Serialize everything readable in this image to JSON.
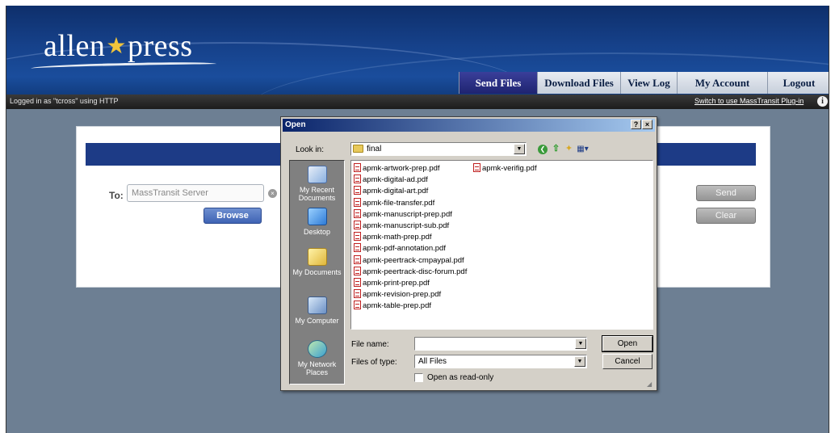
{
  "header": {
    "logo_left": "allen",
    "logo_right": "press",
    "logo_star": "★"
  },
  "nav": {
    "tabs": [
      {
        "label": "Send Files",
        "active": true
      },
      {
        "label": "Download Files",
        "active": false
      },
      {
        "label": "View Log",
        "active": false
      },
      {
        "label": "My Account",
        "active": false
      },
      {
        "label": "Logout",
        "active": false
      }
    ]
  },
  "statusbar": {
    "login_text": "Logged in as \"tcross\" using HTTP",
    "plugin_link": "Switch to use MassTransit Plug-in",
    "info_icon": "i"
  },
  "panel": {
    "to_label": "To:",
    "to_value": "MassTransit Server",
    "clear_icon": "×",
    "browse_label": "Browse",
    "send_label": "Send",
    "clear_label": "Clear"
  },
  "dialog": {
    "title": "Open",
    "help_label": "?",
    "close_label": "×",
    "look_in_label": "Look in:",
    "look_in_value": "final",
    "dropdown_arrow": "▼",
    "toolbar_icons": {
      "back": "❮",
      "up": "⇧",
      "new_folder": "✦",
      "views": "▦▾"
    },
    "places": [
      {
        "label": "My Recent Documents",
        "icon": "recent-documents-icon"
      },
      {
        "label": "Desktop",
        "icon": "desktop-icon"
      },
      {
        "label": "My Documents",
        "icon": "my-documents-icon"
      },
      {
        "label": "My Computer",
        "icon": "my-computer-icon"
      },
      {
        "label": "My Network Places",
        "icon": "network-places-icon"
      }
    ],
    "files": [
      "apmk-artwork-prep.pdf",
      "apmk-digital-ad.pdf",
      "apmk-digital-art.pdf",
      "apmk-file-transfer.pdf",
      "apmk-manuscript-prep.pdf",
      "apmk-manuscript-sub.pdf",
      "apmk-math-prep.pdf",
      "apmk-pdf-annotation.pdf",
      "apmk-peertrack-cmpaypal.pdf",
      "apmk-peertrack-disc-forum.pdf",
      "apmk-print-prep.pdf",
      "apmk-revision-prep.pdf",
      "apmk-table-prep.pdf",
      "apmk-verifig.pdf"
    ],
    "file_name_label": "File name:",
    "file_name_value": "",
    "files_of_type_label": "Files of type:",
    "files_of_type_value": "All Files",
    "read_only_label": "Open as read-only",
    "open_label": "Open",
    "cancel_label": "Cancel",
    "grip": "◢"
  },
  "colors": {
    "header_blue": "#16418a",
    "nav_active": "#1f2470",
    "panel_bar": "#1d3b86",
    "desktop_bg": "#6d7f93",
    "win_face": "#d4d0c8"
  }
}
